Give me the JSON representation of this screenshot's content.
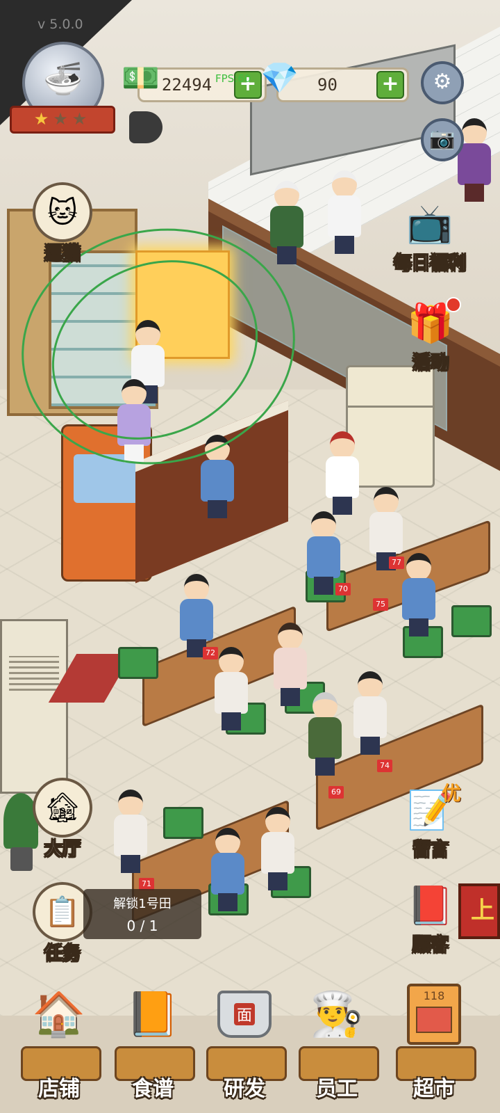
{
  "version": "v 5.0.0",
  "hud": {
    "cash": "22494",
    "gems": "90",
    "fps": "FPS:60",
    "plus_label": "+",
    "stars_filled": 1,
    "stars_total": 3
  },
  "side_left": {
    "cat": "逗猫",
    "hall": "大厅",
    "task": "任务"
  },
  "side_right": {
    "daily": "每日福利",
    "event": "活动",
    "message": "留言",
    "message_tag": "优",
    "customer": "顾客"
  },
  "task_box": {
    "title": "解锁1号田",
    "progress": "0 / 1"
  },
  "bottom_nav": [
    "店铺",
    "食谱",
    "研发",
    "员工",
    "超市"
  ],
  "scene": {
    "order_tickets": [
      "72",
      "70",
      "75",
      "77",
      "74",
      "69",
      "71"
    ],
    "shop_sign": "上",
    "market_sign": "118",
    "pot_label": "面"
  },
  "colors": {
    "plus_green": "#5fae3b",
    "ribbon_red": "#c2452e",
    "doodle_green": "#3aa64a"
  },
  "icons": {
    "cash": "banknote-stack-icon",
    "gem": "diamond-icon",
    "settings": "gear-icon",
    "camera": "camera-icon"
  }
}
